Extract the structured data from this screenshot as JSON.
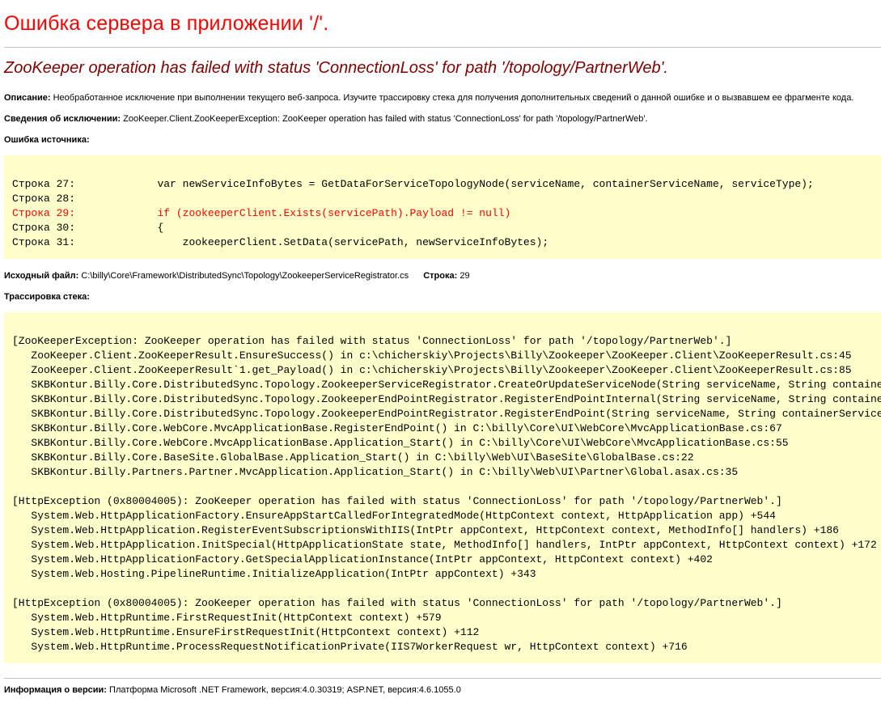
{
  "page": {
    "title": "Ошибка сервера в приложении '/'.",
    "error_message": "ZooKeeper operation has failed with status 'ConnectionLoss' for path '/topology/PartnerWeb'."
  },
  "description": {
    "label": "Описание:",
    "text": "Необработанное исключение при выполнении текущего веб-запроса. Изучите трассировку стека для получения дополнительных сведений о данной ошибке и о вызвавшем ее фрагменте кода."
  },
  "exception_details": {
    "label": "Сведения об исключении:",
    "text": "ZooKeeper.Client.ZooKeeperException: ZooKeeper operation has failed with status 'ConnectionLoss' for path '/topology/PartnerWeb'."
  },
  "source_error": {
    "label": "Ошибка источника:",
    "lines": [
      {
        "label": "Строка 27:",
        "code": "            var newServiceInfoBytes = GetDataForServiceTopologyNode(serviceName, containerServiceName, serviceType);",
        "highlight": false
      },
      {
        "label": "Строка 28:",
        "code": "",
        "highlight": false
      },
      {
        "label": "Строка 29:",
        "code": "            if (zookeeperClient.Exists(servicePath).Payload != null)",
        "highlight": true
      },
      {
        "label": "Строка 30:",
        "code": "            {",
        "highlight": false
      },
      {
        "label": "Строка 31:",
        "code": "                zookeeperClient.SetData(servicePath, newServiceInfoBytes);",
        "highlight": false
      }
    ]
  },
  "source_file": {
    "label": "Исходный файл:",
    "path": "C:\\billy\\Core\\Framework\\DistributedSync\\Topology\\ZookeeperServiceRegistrator.cs",
    "line_label": "Строка:",
    "line_number": "29"
  },
  "stack_trace": {
    "label": "Трассировка стека:",
    "blocks": [
      {
        "header": "[ZooKeeperException: ZooKeeper operation has failed with status 'ConnectionLoss' for path '/topology/PartnerWeb'.]",
        "frames": [
          "ZooKeeper.Client.ZooKeeperResult.EnsureSuccess() in c:\\chicherskiy\\Projects\\Billy\\Zookeeper\\ZooKeeper.Client\\ZooKeeperResult.cs:45",
          "ZooKeeper.Client.ZooKeeperResult`1.get_Payload() in c:\\chicherskiy\\Projects\\Billy\\Zookeeper\\ZooKeeper.Client\\ZooKeeperResult.cs:85",
          "SKBKontur.Billy.Core.DistributedSync.Topology.ZookeeperServiceRegistrator.CreateOrUpdateServiceNode(String serviceName, String containerServiceName, String serviceType)",
          "SKBKontur.Billy.Core.DistributedSync.Topology.ZookeeperEndPointRegistrator.RegisterEndPointInternal(String serviceName, String containerServiceName, String serviceType)",
          "SKBKontur.Billy.Core.DistributedSync.Topology.ZookeeperEndPointRegistrator.RegisterEndPoint(String serviceName, String containerServiceName)",
          "SKBKontur.Billy.Core.WebCore.MvcApplicationBase.RegisterEndPoint() in C:\\billy\\Core\\UI\\WebCore\\MvcApplicationBase.cs:67",
          "SKBKontur.Billy.Core.WebCore.MvcApplicationBase.Application_Start() in C:\\billy\\Core\\UI\\WebCore\\MvcApplicationBase.cs:55",
          "SKBKontur.Billy.Core.BaseSite.GlobalBase.Application_Start() in C:\\billy\\Web\\UI\\BaseSite\\GlobalBase.cs:22",
          "SKBKontur.Billy.Partners.Partner.MvcApplication.Application_Start() in C:\\billy\\Web\\UI\\Partner\\Global.asax.cs:35"
        ]
      },
      {
        "header": "[HttpException (0x80004005): ZooKeeper operation has failed with status 'ConnectionLoss' for path '/topology/PartnerWeb'.]",
        "frames": [
          "System.Web.HttpApplicationFactory.EnsureAppStartCalledForIntegratedMode(HttpContext context, HttpApplication app) +544",
          "System.Web.HttpApplication.RegisterEventSubscriptionsWithIIS(IntPtr appContext, HttpContext context, MethodInfo[] handlers) +186",
          "System.Web.HttpApplication.InitSpecial(HttpApplicationState state, MethodInfo[] handlers, IntPtr appContext, HttpContext context) +172",
          "System.Web.HttpApplicationFactory.GetSpecialApplicationInstance(IntPtr appContext, HttpContext context) +402",
          "System.Web.Hosting.PipelineRuntime.InitializeApplication(IntPtr appContext) +343"
        ]
      },
      {
        "header": "[HttpException (0x80004005): ZooKeeper operation has failed with status 'ConnectionLoss' for path '/topology/PartnerWeb'.]",
        "frames": [
          "System.Web.HttpRuntime.FirstRequestInit(HttpContext context) +579",
          "System.Web.HttpRuntime.EnsureFirstRequestInit(HttpContext context) +112",
          "System.Web.HttpRuntime.ProcessRequestNotificationPrivate(IIS7WorkerRequest wr, HttpContext context) +716"
        ]
      }
    ]
  },
  "version_info": {
    "label": "Информация о версии:",
    "text": "Платформа Microsoft .NET Framework, версия:4.0.30319; ASP.NET, версия:4.6.1055.0"
  },
  "colors": {
    "title": "#ff0000",
    "error_message": "#800000",
    "code_background": "#ffffcc",
    "highlight_line": "#ff0000"
  }
}
